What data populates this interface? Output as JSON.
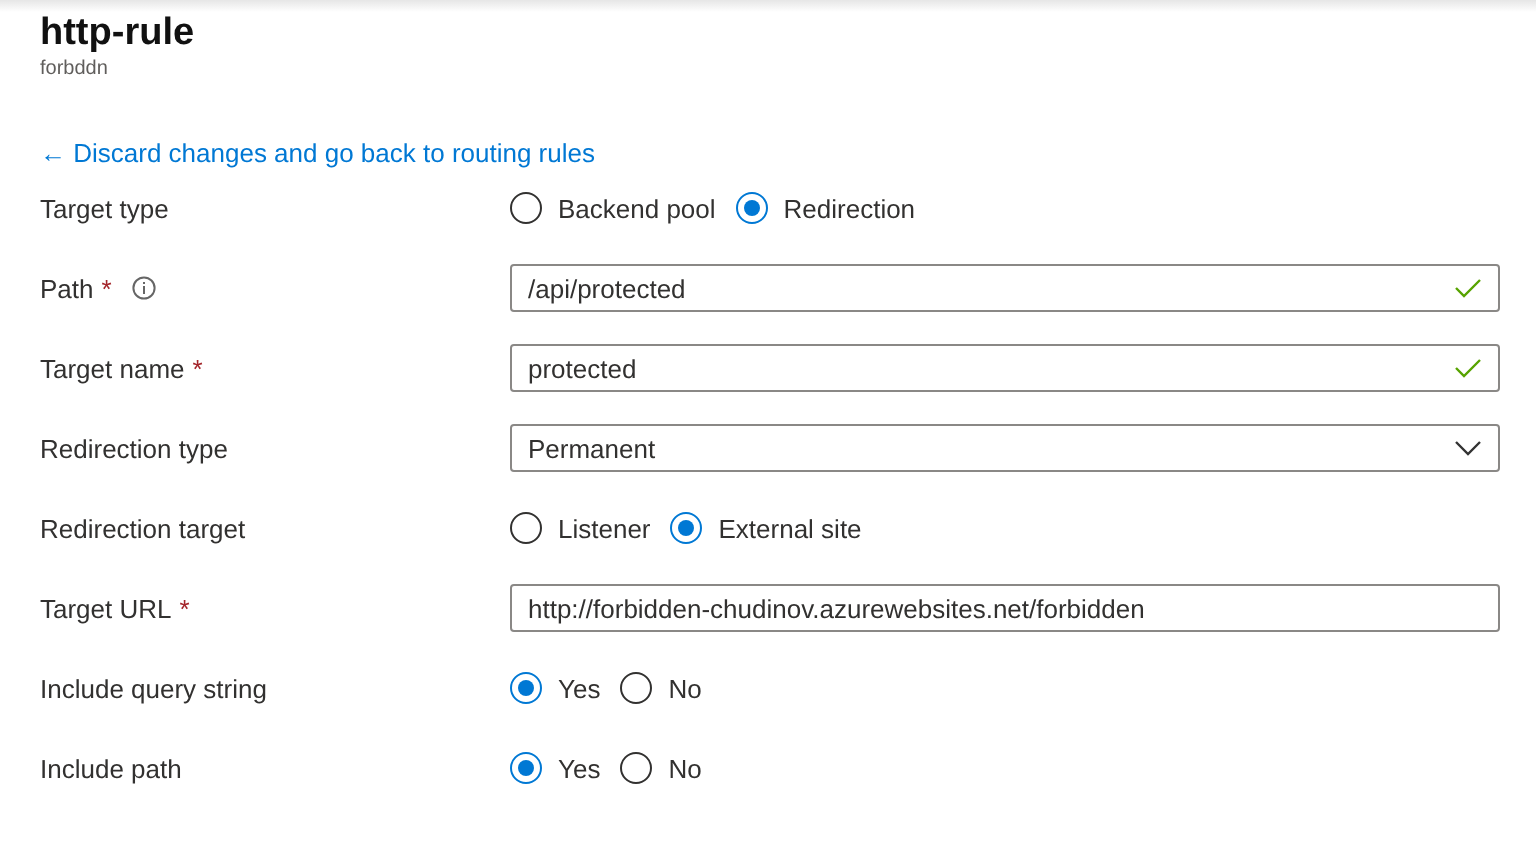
{
  "header": {
    "title": "http-rule",
    "subtitle": "forbddn"
  },
  "back_link": {
    "arrow": "←",
    "label": "Discard changes and go back to routing rules"
  },
  "fields": [
    {
      "kind": "radio",
      "label": "Target type",
      "options": [
        {
          "label": "Backend pool",
          "selected": false
        },
        {
          "label": "Redirection",
          "selected": true
        }
      ]
    },
    {
      "kind": "text",
      "label": "Path",
      "required_mark": "*",
      "info": true,
      "value": "/api/protected",
      "valid": true
    },
    {
      "kind": "text",
      "label": "Target name",
      "required_mark": "*",
      "value": "protected",
      "valid": true
    },
    {
      "kind": "select",
      "label": "Redirection type",
      "value": "Permanent"
    },
    {
      "kind": "radio",
      "label": "Redirection target",
      "options": [
        {
          "label": "Listener",
          "selected": false
        },
        {
          "label": "External site",
          "selected": true
        }
      ]
    },
    {
      "kind": "text",
      "label": "Target URL",
      "required_mark": "*",
      "value": "http://forbidden-chudinov.azurewebsites.net/forbidden"
    },
    {
      "kind": "radio",
      "label": "Include query string",
      "options": [
        {
          "label": "Yes",
          "selected": true
        },
        {
          "label": "No",
          "selected": false
        }
      ]
    },
    {
      "kind": "radio",
      "label": "Include path",
      "options": [
        {
          "label": "Yes",
          "selected": true
        },
        {
          "label": "No",
          "selected": false
        }
      ]
    }
  ]
}
